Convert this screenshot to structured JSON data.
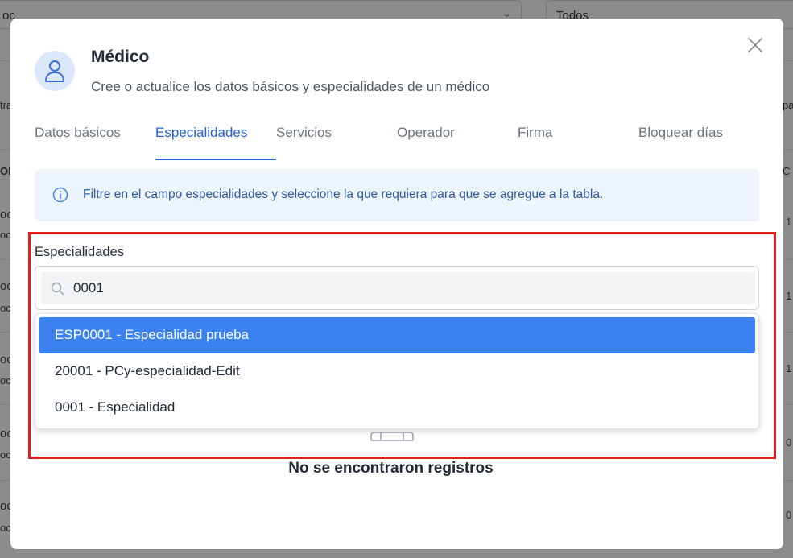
{
  "background": {
    "filter_left_value": "oc",
    "filter_right_value": "Todos",
    "row_prefixes": [
      "tra",
      "OM",
      "oc",
      "oct",
      "oc",
      "oct",
      "oc",
      "oct",
      "oc",
      "oct",
      "oc",
      "oct"
    ],
    "right_values": [
      "pa",
      "C",
      "1",
      "1",
      "1",
      "0",
      "0"
    ]
  },
  "modal": {
    "title": "Médico",
    "subtitle": "Cree o actualice los datos básicos y especialidades de un médico",
    "tabs": [
      {
        "label": "Datos básicos"
      },
      {
        "label": "Especialidades"
      },
      {
        "label": "Servicios"
      },
      {
        "label": "Operador"
      },
      {
        "label": "Firma"
      },
      {
        "label": "Bloquear días"
      }
    ],
    "active_tab": "Especialidades",
    "info_text": "Filtre en el campo especialidades y seleccione la que requiera para que se agregue a la tabla.",
    "field": {
      "label": "Especialidades",
      "value": "0001"
    },
    "options": [
      {
        "label": "ESP0001 - Especialidad prueba",
        "selected": true
      },
      {
        "label": "20001 - PCy-especialidad-Edit",
        "selected": false
      },
      {
        "label": "0001 - Especialidad",
        "selected": false
      }
    ],
    "empty_text": "No se encontraron registros"
  },
  "colors": {
    "accent": "#2563d6",
    "selected_option": "#3b82f0",
    "info_bg": "#eef4fc",
    "highlight": "#e02020"
  }
}
